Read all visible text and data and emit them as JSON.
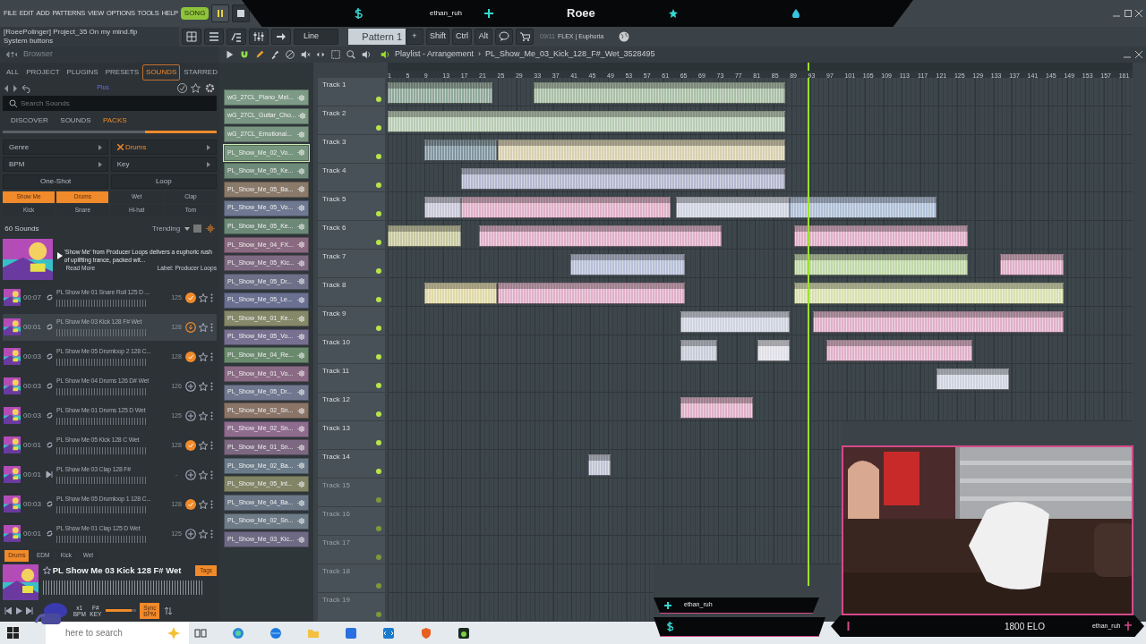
{
  "menu": [
    "FILE",
    "EDIT",
    "ADD",
    "PATTERNS",
    "VIEW",
    "OPTIONS",
    "TOOLS",
    "HELP"
  ],
  "transport": {
    "mode": {
      "label": "SONG",
      "selected": true
    },
    "playing": true
  },
  "stream_overlay": {
    "top_name": "ethan_ruh",
    "top_title": "Roee",
    "bottom_name": "ethan_ruh",
    "elo": "1800 ELO",
    "corner_name": "ethan_ruh"
  },
  "hint": {
    "title": "[RoeePolinger] Project_35 On my mind.flp",
    "text": "System buttons"
  },
  "toolbar": {
    "snap": "Line",
    "pattern": "Pattern 1",
    "pattern_add": "+",
    "modifiers": [
      "Shift",
      "Ctrl",
      "Alt"
    ],
    "counter": "09/11",
    "news": "FLEX | Euphoria"
  },
  "browser": {
    "title": "Browser",
    "tabs": [
      {
        "label": "ALL",
        "selected": false
      },
      {
        "label": "PROJECT",
        "selected": false
      },
      {
        "label": "PLUGINS",
        "selected": false
      },
      {
        "label": "PRESETS",
        "selected": false
      },
      {
        "label": "SOUNDS",
        "selected": true
      },
      {
        "label": "STARRED",
        "selected": false
      }
    ],
    "badge": "Plus",
    "search": {
      "placeholder": "Search Sounds"
    },
    "sections": [
      {
        "label": "DISCOVER",
        "selected": false
      },
      {
        "label": "SOUNDS",
        "selected": false
      },
      {
        "label": "PACKS",
        "selected": true
      }
    ],
    "filters": [
      {
        "label": "Genre",
        "active": false
      },
      {
        "label": "Drums",
        "active": true
      },
      {
        "label": "BPM",
        "active": false
      },
      {
        "label": "Key",
        "active": false
      }
    ],
    "types": [
      {
        "label": "One-Shot",
        "selected": false
      },
      {
        "label": "Loop",
        "selected": false
      }
    ],
    "tags": [
      {
        "label": "Show Me",
        "selected": true
      },
      {
        "label": "Drums",
        "selected": true
      },
      {
        "label": "Wet",
        "selected": false
      },
      {
        "label": "Clap",
        "selected": false
      },
      {
        "label": "Kick",
        "selected": false
      },
      {
        "label": "Snare",
        "selected": false
      },
      {
        "label": "Hi-hat",
        "selected": false
      },
      {
        "label": "Tom",
        "selected": false
      }
    ],
    "count": "60 Sounds",
    "sort": "Trending",
    "pack": {
      "description": "'Show Me' from Producer Loops delivers a euphoric rush of uplifting trance, packed wit...",
      "more": "Read More",
      "label": "Label: Producer Loops"
    },
    "sounds": [
      {
        "duration": "00:07",
        "kind": "loop",
        "name": "PL Show Me 01 Snare Roll 125 D ...",
        "bpm": "125",
        "added": true,
        "downloading": false,
        "selected": false
      },
      {
        "duration": "00:01",
        "kind": "loop",
        "name": "PL Show Me 03 Kick 128 F# Wet",
        "bpm": "128",
        "added": false,
        "downloading": true,
        "selected": true
      },
      {
        "duration": "00:03",
        "kind": "loop",
        "name": "PL Show Me 05 Drumloop 2 128 C...",
        "bpm": "128",
        "added": true,
        "downloading": false,
        "selected": false
      },
      {
        "duration": "00:03",
        "kind": "loop",
        "name": "PL Show Me 04 Drums 126 D# Wet",
        "bpm": "126",
        "added": false,
        "downloading": false,
        "selected": false
      },
      {
        "duration": "00:03",
        "kind": "loop",
        "name": "PL Show Me 01 Drums 125 D Wet",
        "bpm": "125",
        "added": false,
        "downloading": false,
        "selected": false
      },
      {
        "duration": "00:01",
        "kind": "loop",
        "name": "PL Show Me 05 Kick 128 C Wet",
        "bpm": "128",
        "added": true,
        "downloading": false,
        "selected": false
      },
      {
        "duration": "00:01",
        "kind": "oneshot",
        "name": "PL Show Me 03 Clap 128 F#",
        "bpm": "-",
        "added": false,
        "downloading": false,
        "selected": false
      },
      {
        "duration": "00:03",
        "kind": "loop",
        "name": "PL Show Me 05 Drumloop 1 128 C...",
        "bpm": "128",
        "added": true,
        "downloading": false,
        "selected": false
      },
      {
        "duration": "00:01",
        "kind": "loop",
        "name": "PL Show Me 01 Clap 125 D Wet",
        "bpm": "125",
        "added": false,
        "downloading": false,
        "selected": false
      }
    ],
    "preview": {
      "tags": [
        {
          "label": "Drums",
          "selected": true
        },
        {
          "label": "EDM",
          "selected": false
        },
        {
          "label": "Kick",
          "selected": false
        },
        {
          "label": "Wet",
          "selected": false
        }
      ],
      "title": "PL Show Me 03 Kick 128 F# Wet",
      "tag_button": "Tags",
      "speed": "x1",
      "speed_label": "BPM",
      "key": "F#",
      "key_label": "KEY",
      "volume": {
        "level": 0.85
      },
      "sync": {
        "label": "Sync BPM",
        "on": true
      }
    }
  },
  "patterns": [
    {
      "name": "wG_27CL_Piano_Mel...",
      "color": "#7d9a86",
      "selected": false
    },
    {
      "name": "wG_27CL_Guitar_Cho...",
      "color": "#7a9682",
      "selected": false
    },
    {
      "name": "wG_27CL_Emotional...",
      "color": "#7a9682",
      "selected": false
    },
    {
      "name": "PL_Show_Me_02_Vo...",
      "color": "#76967e",
      "selected": true
    },
    {
      "name": "PL_Show_Me_05_Ke...",
      "color": "#6e8a78",
      "selected": false
    },
    {
      "name": "PL_Show_Me_05_Ba...",
      "color": "#8a7a6a",
      "selected": false
    },
    {
      "name": "PL_Show_Me_05_Vo...",
      "color": "#6e7890",
      "selected": false
    },
    {
      "name": "PL_Show_Me_05_Ke...",
      "color": "#6c8876",
      "selected": false
    },
    {
      "name": "PL_Show_Me_04_FX...",
      "color": "#8a6a80",
      "selected": false
    },
    {
      "name": "PL_Show_Me_05_Kic...",
      "color": "#7e6a82",
      "selected": false
    },
    {
      "name": "PL_Show_Me_05_Dr...",
      "color": "#6e7088",
      "selected": false
    },
    {
      "name": "PL_Show_Me_05_Le...",
      "color": "#6a7090",
      "selected": false
    },
    {
      "name": "PL_Show_Me_01_Ke...",
      "color": "#86886a",
      "selected": false
    },
    {
      "name": "PL_Show_Me_05_Vo...",
      "color": "#787090",
      "selected": false
    },
    {
      "name": "PL_Show_Me_04_Re...",
      "color": "#6a8a6e",
      "selected": false
    },
    {
      "name": "PL_Show_Me_01_Vo...",
      "color": "#8a6a84",
      "selected": false
    },
    {
      "name": "PL_Show_Me_05_Dr...",
      "color": "#707890",
      "selected": false
    },
    {
      "name": "PL_Show_Me_02_Sn...",
      "color": "#8a7468",
      "selected": false
    },
    {
      "name": "PL_Show_Me_02_Sn...",
      "color": "#8e6c8e",
      "selected": false
    },
    {
      "name": "PL_Show_Me_01_Sn...",
      "color": "#7c6880",
      "selected": false
    },
    {
      "name": "PL_Show_Me_02_Ba...",
      "color": "#6a7a88",
      "selected": false
    },
    {
      "name": "PL_Show_Me_05_Int...",
      "color": "#828466",
      "selected": false
    },
    {
      "name": "PL_Show_Me_04_Ba...",
      "color": "#6c7888",
      "selected": false
    },
    {
      "name": "PL_Show_Me_02_Sn...",
      "color": "#6e7c88",
      "selected": false
    },
    {
      "name": "PL_Show_Me_03_Kic...",
      "color": "#6e6a84",
      "selected": false
    }
  ],
  "playlist": {
    "title": "Playlist - Arrangement",
    "separator": "›",
    "clip": "PL_Show_Me_03_Kick_128_F#_Wet_3528495",
    "ruler": [
      "1",
      "5",
      "9",
      "13",
      "17",
      "21",
      "25",
      "29",
      "33",
      "37",
      "41",
      "45",
      "49",
      "53",
      "57",
      "61",
      "65",
      "69",
      "73",
      "77",
      "81",
      "85",
      "89",
      "93",
      "97",
      "101",
      "105",
      "109",
      "113",
      "117",
      "121",
      "125",
      "129",
      "133",
      "137",
      "141",
      "145",
      "149",
      "153",
      "157",
      "161"
    ],
    "playhead": {
      "level": 0.564
    },
    "tracks": [
      {
        "name": "Track 1",
        "empty": false
      },
      {
        "name": "Track 2",
        "empty": false
      },
      {
        "name": "Track 3",
        "empty": false
      },
      {
        "name": "Track 4",
        "empty": false
      },
      {
        "name": "Track 5",
        "empty": false
      },
      {
        "name": "Track 6",
        "empty": false
      },
      {
        "name": "Track 7",
        "empty": false
      },
      {
        "name": "Track 8",
        "empty": false
      },
      {
        "name": "Track 9",
        "empty": false
      },
      {
        "name": "Track 10",
        "empty": false
      },
      {
        "name": "Track 11",
        "empty": false
      },
      {
        "name": "Track 12",
        "empty": false
      },
      {
        "name": "Track 13",
        "empty": false
      },
      {
        "name": "Track 14",
        "empty": false
      },
      {
        "name": "Track 15",
        "empty": true
      },
      {
        "name": "Track 16",
        "empty": true
      },
      {
        "name": "Track 17",
        "empty": true
      },
      {
        "name": "Track 18",
        "empty": true
      },
      {
        "name": "Track 19",
        "empty": true
      }
    ]
  },
  "taskbar": {
    "search": {
      "placeholder": "here to search"
    }
  }
}
